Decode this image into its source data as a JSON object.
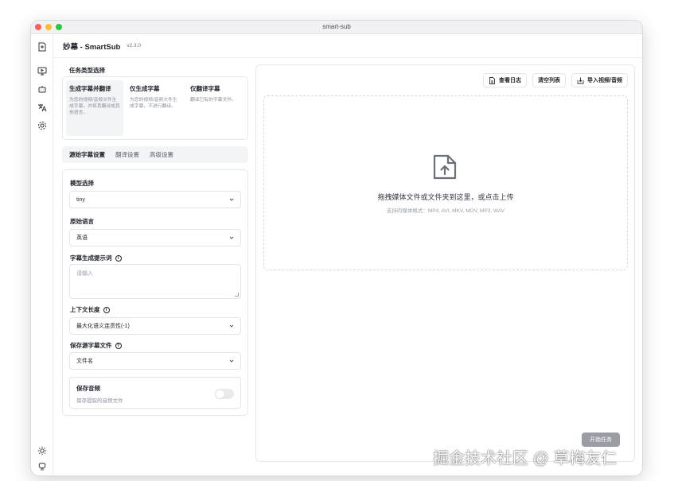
{
  "window": {
    "title": "smart-sub"
  },
  "app": {
    "name": "妙幕 - SmartSub",
    "version": "v2.3.0"
  },
  "task_section": {
    "title": "任务类型选择",
    "options": [
      {
        "title": "生成字幕并翻译",
        "desc": "为您的视频/音频文件生成字幕，并将其翻译成其他语言。",
        "active": true
      },
      {
        "title": "仅生成字幕",
        "desc": "为您的视频/音频文件生成字幕，不进行翻译。",
        "active": false
      },
      {
        "title": "仅翻译字幕",
        "desc": "翻译已有的字幕文件。",
        "active": false
      }
    ]
  },
  "tabs": [
    "源始字幕设置",
    "翻译设置",
    "高级设置"
  ],
  "form": {
    "model_label": "模型选择",
    "model_value": "tiny",
    "lang_label": "原始语言",
    "lang_value": "英语",
    "prompt_label": "字幕生成提示词",
    "prompt_placeholder": "请输入",
    "context_label": "上下文长度",
    "context_value": "最大化语义连贯性(-1)",
    "save_label": "保存源字幕文件",
    "save_value": "文件名",
    "audio_title": "保存音频",
    "audio_desc": "保存提取的音频文件",
    "audio_enabled": false
  },
  "toolbar": {
    "log": "查看日志",
    "clear": "清空列表",
    "import": "导入视频/音频"
  },
  "dropzone": {
    "text": "拖拽媒体文件或文件夹到这里，或点击上传",
    "formats": "支持的媒体格式：MP4, AVI, MKV, MOV, MP3, WAV"
  },
  "start_button": "开始任务",
  "watermark": "掘金技术社区 @ 草梅友仁"
}
